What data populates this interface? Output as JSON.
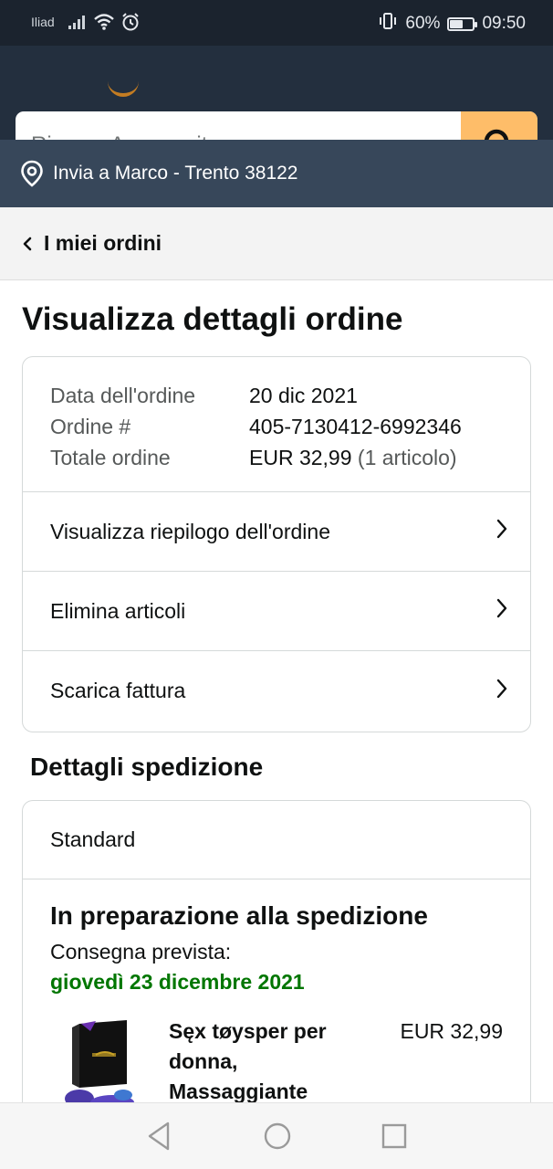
{
  "status_bar": {
    "carrier": "Iliad",
    "battery_percent": "60%",
    "battery_level": 0.6,
    "time": "09:50",
    "icons": [
      "signal-icon",
      "wifi-icon",
      "alarm-icon",
      "vibrate-icon",
      "battery-icon"
    ]
  },
  "header": {
    "search_placeholder": "Ricerca Amazon.it",
    "search_icon": "search-icon"
  },
  "delivery": {
    "text": "Invia a Marco - Trento 38122",
    "icon": "location-pin-icon"
  },
  "back_nav": {
    "label": "I miei ordini"
  },
  "page_title": "Visualizza dettagli ordine",
  "order_summary": {
    "date_label": "Data dell'ordine",
    "date_value": "20 dic 2021",
    "number_label": "Ordine #",
    "number_value": "405-7130412-6992346",
    "total_label": "Totale ordine",
    "total_value": "EUR 32,99",
    "total_items": "(1 articolo)"
  },
  "order_links": [
    {
      "label": "Visualizza riepilogo dell'ordine"
    },
    {
      "label": "Elimina articoli"
    },
    {
      "label": "Scarica fattura"
    }
  ],
  "shipping": {
    "section_title": "Dettagli spedizione",
    "type": "Standard",
    "status_title": "In preparazione alla spedizione",
    "eta_label": "Consegna prevista:",
    "eta_date": "giovedì 23 dicembre 2021",
    "product": {
      "name": "Sęx tøysper per donna, Massaggiante",
      "price": "EUR 32,99"
    }
  },
  "colors": {
    "header_bg": "#232f3e",
    "delivery_bg": "#37475a",
    "search_button": "#febd69",
    "eta_green": "#007600"
  }
}
